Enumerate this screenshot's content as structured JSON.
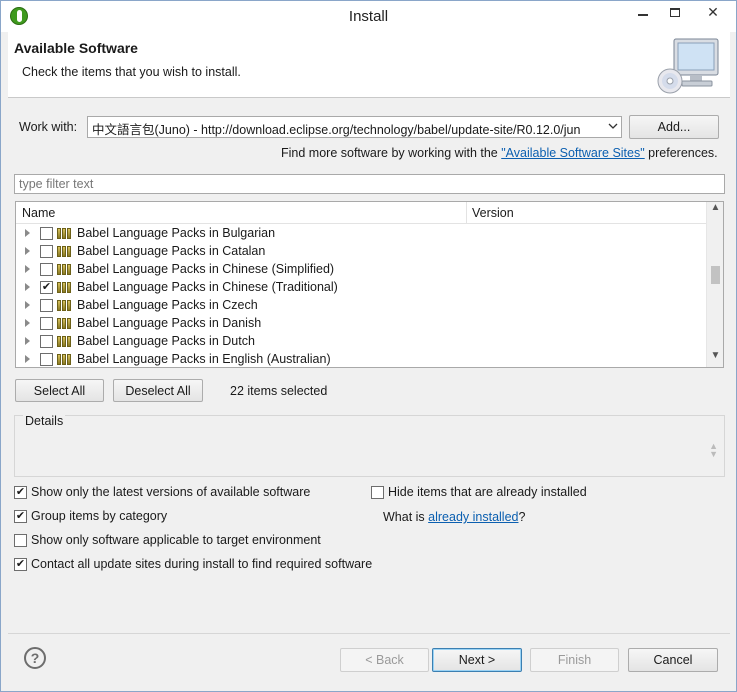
{
  "window": {
    "title": "Install",
    "close_glyph": "✕"
  },
  "banner": {
    "heading": "Available Software",
    "subtitle": "Check the items that you wish to install."
  },
  "workwith": {
    "label": "Work with:",
    "value": "中文語言包(Juno) - http://download.eclipse.org/technology/babel/update-site/R0.12.0/jun",
    "add_button": "Add...",
    "find_more_prefix": "Find more software by working with the ",
    "find_more_link": "\"Available Software Sites\"",
    "find_more_suffix": " preferences."
  },
  "filter": {
    "placeholder": "type filter text"
  },
  "tree": {
    "columns": [
      "Name",
      "Version"
    ],
    "items": [
      {
        "label": "Babel Language Packs in Bulgarian",
        "checked": false
      },
      {
        "label": "Babel Language Packs in Catalan",
        "checked": false
      },
      {
        "label": "Babel Language Packs in Chinese (Simplified)",
        "checked": false
      },
      {
        "label": "Babel Language Packs in Chinese (Traditional)",
        "checked": true
      },
      {
        "label": "Babel Language Packs in Czech",
        "checked": false
      },
      {
        "label": "Babel Language Packs in Danish",
        "checked": false
      },
      {
        "label": "Babel Language Packs in Dutch",
        "checked": false
      },
      {
        "label": "Babel Language Packs in English (Australian)",
        "checked": false
      }
    ]
  },
  "selection": {
    "select_all": "Select All",
    "deselect_all": "Deselect All",
    "count_text": "22 items selected"
  },
  "details": {
    "legend": "Details"
  },
  "options": {
    "latest_only": {
      "label": "Show only the latest versions of available software",
      "checked": true
    },
    "hide_installed": {
      "label": "Hide items that are already installed",
      "checked": false
    },
    "group_by_category": {
      "label": "Group items by category",
      "checked": true
    },
    "what_is_prefix": "What is ",
    "what_is_link": "already installed",
    "what_is_suffix": "?",
    "target_env": {
      "label": "Show only software applicable to target environment",
      "checked": false
    },
    "contact_sites": {
      "label": "Contact all update sites during install to find required software",
      "checked": true
    }
  },
  "footer": {
    "help_glyph": "?",
    "back": "< Back",
    "next": "Next >",
    "finish": "Finish",
    "cancel": "Cancel"
  },
  "icons": {
    "app": "eclipse-install-icon",
    "banner": "monitor-cd-icon",
    "package": "package-icon"
  },
  "colors": {
    "link": "#0b5fb0",
    "checkmark": "#1a1a1a"
  }
}
